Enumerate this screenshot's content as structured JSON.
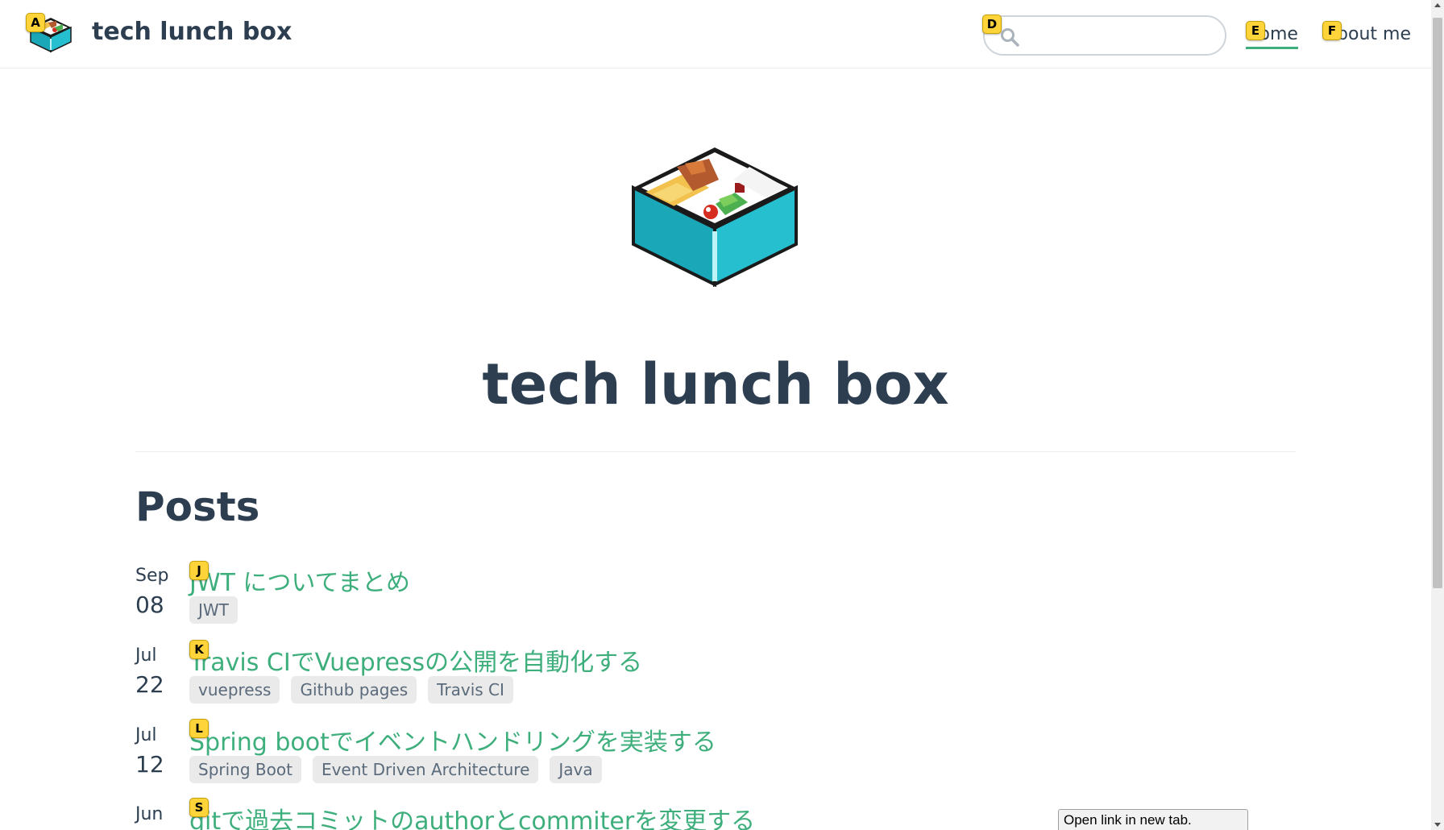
{
  "navbar": {
    "site_title": "tech lunch box",
    "search": {
      "value": "",
      "placeholder": ""
    },
    "links": [
      {
        "label": "Home",
        "active": true
      },
      {
        "label": "About me",
        "active": false
      }
    ]
  },
  "hero": {
    "title": "tech lunch box"
  },
  "posts_section": {
    "heading": "Posts",
    "posts": [
      {
        "month": "Sep",
        "day": "08",
        "title": "JWT についてまとめ",
        "tags": [
          "JWT"
        ]
      },
      {
        "month": "Jul",
        "day": "22",
        "title": "Travis CIでVuepressの公開を自動化する",
        "tags": [
          "vuepress",
          "Github pages",
          "Travis CI"
        ]
      },
      {
        "month": "Jul",
        "day": "12",
        "title": "Spring bootでイベントハンドリングを実装する",
        "tags": [
          "Spring Boot",
          "Event Driven Architecture",
          "Java"
        ]
      },
      {
        "month": "Jun",
        "day": "",
        "title": "gitで過去コミットのauthorとcommiterを変更する",
        "tags": []
      }
    ]
  },
  "hints": {
    "logo": "A",
    "search": "D",
    "home": "E",
    "about": "F",
    "post_0": "J",
    "post_1": "K",
    "post_2": "L",
    "post_3": "S"
  },
  "status_popup": {
    "text": "Open link in new tab."
  },
  "colors": {
    "accent": "#3eaf7c",
    "text": "#2c3e50",
    "tag_bg": "#eaeaea",
    "hint_bg": "#ffd43b"
  },
  "icons": {
    "logo": "bento-box-icon",
    "search": "search-icon"
  }
}
